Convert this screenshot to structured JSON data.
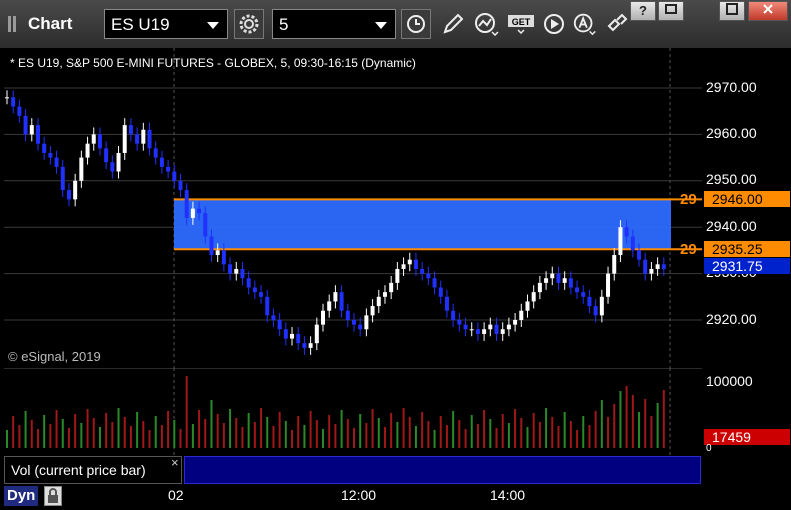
{
  "window": {
    "title": "Chart",
    "symbol_value": "ES U19",
    "interval_value": "5",
    "buttons": [
      "help",
      "restore",
      "maximize",
      "close"
    ],
    "help_label": "?"
  },
  "chart": {
    "info": "* ES U19, S&P 500 E-MINI FUTURES - GLOBEX, 5, 09:30-16:15 (Dynamic)",
    "copyright": "© eSignal, 2019",
    "price_labels": [
      "2970.00",
      "2960.00",
      "2950.00",
      "2940.00",
      "2930.00",
      "2920.00"
    ],
    "price_tags": {
      "upper": "2946.00",
      "lower": "2935.25",
      "last": "2931.75",
      "upper_side": "29",
      "lower_side": "29"
    },
    "volume_labels": {
      "top": "100000",
      "current": "17459",
      "zero": "0"
    },
    "volume_panel_label": "Vol (current price bar)",
    "close_label": "×",
    "time_labels": [
      "02",
      "12:00",
      "14:00"
    ],
    "dyn_label": "Dyn"
  },
  "colors": {
    "up_candle": "#ffffff",
    "down_candle": "#2030ff",
    "zone_fill": "#2d6bff",
    "zone_border": "#ff8c00",
    "last_price_bg": "#0022cc",
    "vol_current_bg": "#cc0000"
  }
}
